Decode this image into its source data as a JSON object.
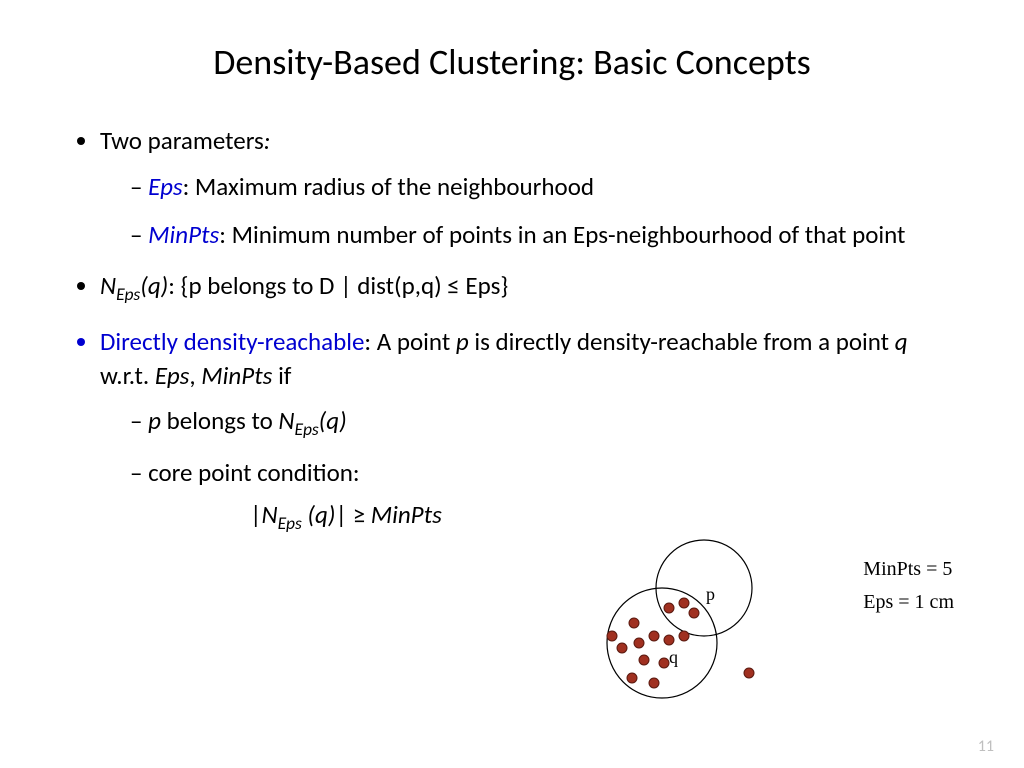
{
  "title": "Density-Based Clustering: Basic Concepts",
  "bullets": {
    "two_params": "Two parameters",
    "eps_term": "Eps",
    "eps_def": ": Maximum radius of the neighbourhood",
    "minpts_term": "MinPts",
    "minpts_def": ": Minimum number of points in an Eps-neighbourhood of that point",
    "neps_prefix": "N",
    "neps_sub": "Eps",
    "neps_arg": "(q)",
    "neps_def": ": {p belongs to D | dist(p,q) ≤ Eps}",
    "ddr_term": "Directly density-reachable",
    "ddr_def1": ": A point ",
    "ddr_p": "p",
    "ddr_def2": " is directly density-reachable from a point ",
    "ddr_q": "q",
    "ddr_def3": " w.r.t. ",
    "ddr_eps": "Eps",
    "ddr_comma": ", ",
    "ddr_minpts": "MinPts",
    "ddr_if": " if",
    "sub_p": "p",
    "sub_belongs": " belongs to ",
    "sub_n": "N",
    "sub_eps": "Eps",
    "sub_q": "(q)",
    "core_cond": "core point condition:",
    "formula_bar1": "|",
    "formula_n": "N",
    "formula_eps": "Eps",
    "formula_q": " (q)",
    "formula_bar2": "| ≥ ",
    "formula_minpts": "MinPts"
  },
  "diagram": {
    "p_label": "p",
    "q_label": "q",
    "minpts_label": "MinPts = 5",
    "eps_label": "Eps = 1 cm"
  },
  "page_number": "11"
}
